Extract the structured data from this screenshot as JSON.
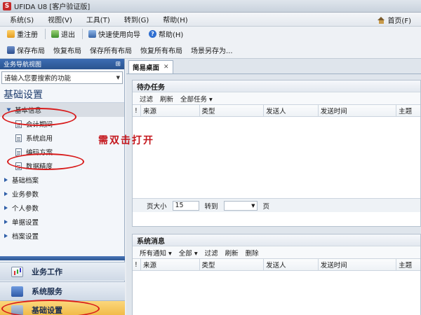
{
  "window": {
    "logo": "S",
    "title": "UFIDA U8 [客户验证版]"
  },
  "menu": {
    "items": [
      "系统(S)",
      "视图(V)",
      "工具(T)",
      "转到(G)",
      "帮助(H)"
    ],
    "homepage": "首页(F)"
  },
  "toolbar1": {
    "buttons": [
      "重注册",
      "退出",
      "快速使用向导",
      "帮助(H)"
    ]
  },
  "toolbar2": {
    "buttons": [
      "保存布局",
      "恢复布局",
      "保存所有布局",
      "恢复所有布局",
      "场景另存为..."
    ]
  },
  "sidebar": {
    "header": "业务导航视图",
    "search_placeholder": "请输入您要搜索的功能",
    "title": "基础设置",
    "items": [
      {
        "label": "基本信息",
        "level": 0
      },
      {
        "label": "会计期间",
        "level": 1
      },
      {
        "label": "系统启用",
        "level": 1
      },
      {
        "label": "编码方案",
        "level": 1
      },
      {
        "label": "数据精度",
        "level": 1
      }
    ],
    "groups": [
      "基础档案",
      "业务参数",
      "个人参数",
      "单据设置",
      "档案设置"
    ],
    "nav_buttons": [
      "业务工作",
      "系统服务",
      "基础设置"
    ]
  },
  "annotation": "需双击打开",
  "tabs": [
    {
      "label": "简易桌面"
    }
  ],
  "todo": {
    "title": "待办任务",
    "actions": [
      "过滤",
      "刷新",
      "全部任务 ▾"
    ],
    "columns": [
      "!",
      "来源",
      "类型",
      "发送人",
      "发送时间",
      "主题"
    ],
    "pager": {
      "page_size_label": "页大小",
      "page_size": "15",
      "goto_label": "转到",
      "page_label": "页"
    }
  },
  "messages": {
    "title": "系统消息",
    "actions": [
      "所有通知 ▾",
      "全部 ▾",
      "过滤",
      "刷新",
      "删除"
    ],
    "columns": [
      "!",
      "来源",
      "类型",
      "发送人",
      "发送时间",
      "主题"
    ]
  }
}
